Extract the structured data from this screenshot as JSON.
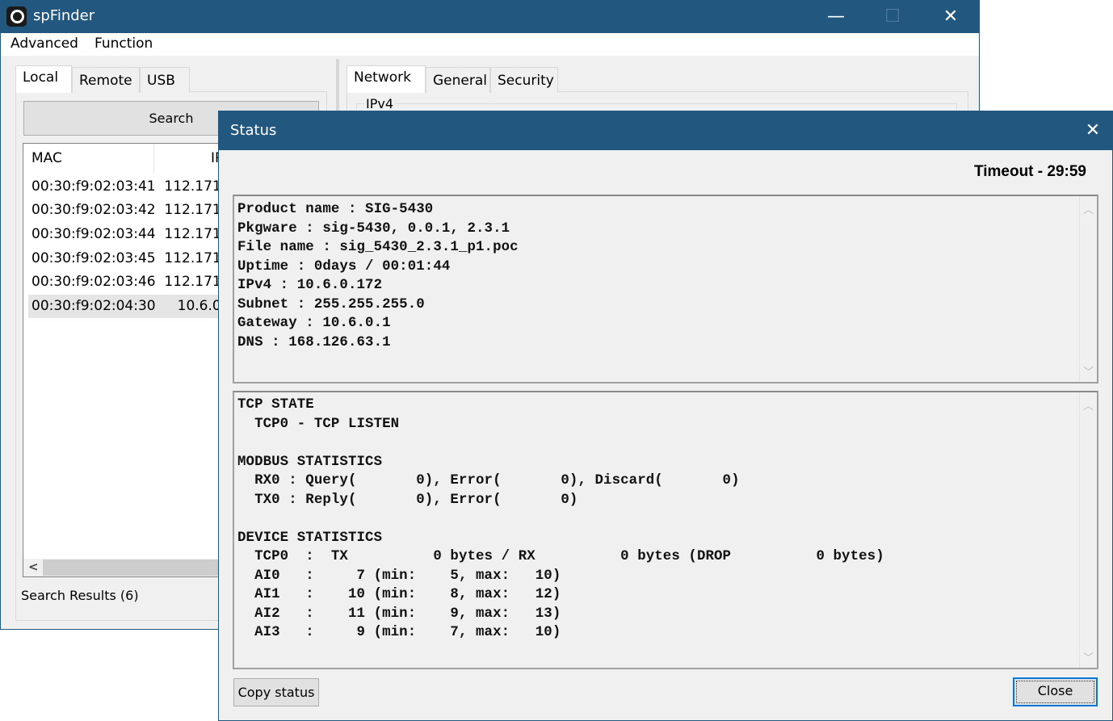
{
  "main_window": {
    "title": "spFinder",
    "controls": {
      "minimize": "—",
      "maximize": "☐",
      "close": "✕"
    },
    "menu": [
      "Advanced",
      "Function"
    ],
    "left_tabs": [
      {
        "label": "Local",
        "active": true
      },
      {
        "label": "Remote"
      },
      {
        "label": "USB"
      }
    ],
    "search_button": "Search",
    "columns": [
      "MAC",
      "IP"
    ],
    "rows": [
      {
        "mac": "00:30:f9:02:03:41",
        "ip": "112.171"
      },
      {
        "mac": "00:30:f9:02:03:42",
        "ip": "112.171"
      },
      {
        "mac": "00:30:f9:02:03:44",
        "ip": "112.171"
      },
      {
        "mac": "00:30:f9:02:03:45",
        "ip": "112.171"
      },
      {
        "mac": "00:30:f9:02:03:46",
        "ip": "112.171"
      },
      {
        "mac": "00:30:f9:02:04:30",
        "ip": "10.6.0",
        "selected": true
      }
    ],
    "scroll_left": "<",
    "search_results": "Search Results (6)",
    "right_tabs": [
      {
        "label": "Network",
        "active": true
      },
      {
        "label": "General"
      },
      {
        "label": "Security"
      }
    ],
    "group_ipv4": "IPv4"
  },
  "status_dialog": {
    "title": "Status",
    "close": "✕",
    "timeout": "Timeout - 29:59",
    "info_text": "Product name : SIG-5430\nPkgware : sig-5430, 0.0.1, 2.3.1\nFile name : sig_5430_2.3.1_p1.poc\nUptime : 0days / 00:01:44\nIPv4 : 10.6.0.172\nSubnet : 255.255.255.0\nGateway : 10.6.0.1\nDNS : 168.126.63.1",
    "stats_text": "TCP STATE\n  TCP0 - TCP LISTEN\n\nMODBUS STATISTICS\n  RX0 : Query(       0), Error(       0), Discard(       0)\n  TX0 : Reply(       0), Error(       0)\n\nDEVICE STATISTICS\n  TCP0  :  TX          0 bytes / RX          0 bytes (DROP          0 bytes)\n  AI0   :     7 (min:    5, max:   10)\n  AI1   :    10 (min:    8, max:   12)\n  AI2   :    11 (min:    9, max:   13)\n  AI3   :     9 (min:    7, max:   10)",
    "copy_button": "Copy status",
    "close_button": "Close"
  },
  "colors": {
    "titlebar": "#22577f",
    "focus": "#0078d7"
  }
}
